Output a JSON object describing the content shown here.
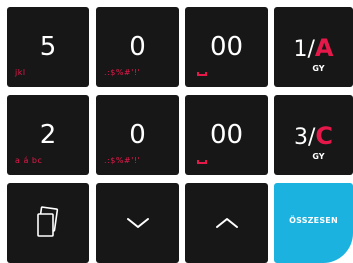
{
  "keypad": {
    "row1": [
      {
        "main": "5",
        "sub": "jkl"
      },
      {
        "main": "0",
        "sub": ".:$%#'!'"
      },
      {
        "main": "00",
        "sub_icon": "space-bar-icon"
      },
      {
        "prefix": "1/",
        "letter": "A",
        "sub": "GY"
      }
    ],
    "row2": [
      {
        "main": "2",
        "sub": "a á bc"
      },
      {
        "main": "0",
        "sub": ".:$%#'!'"
      },
      {
        "main": "00",
        "sub_icon": "space-bar-icon"
      },
      {
        "prefix": "3/",
        "letter": "C",
        "sub": "GY"
      }
    ],
    "row3": [
      {
        "icon": "copy-cards-icon"
      },
      {
        "icon": "chevron-down-icon"
      },
      {
        "icon": "chevron-up-icon"
      },
      {
        "label": "ÖSSZESEN"
      }
    ]
  },
  "colors": {
    "key_bg": "#171717",
    "accent_red": "#e6184a",
    "accent_blue": "#1bb2df"
  }
}
